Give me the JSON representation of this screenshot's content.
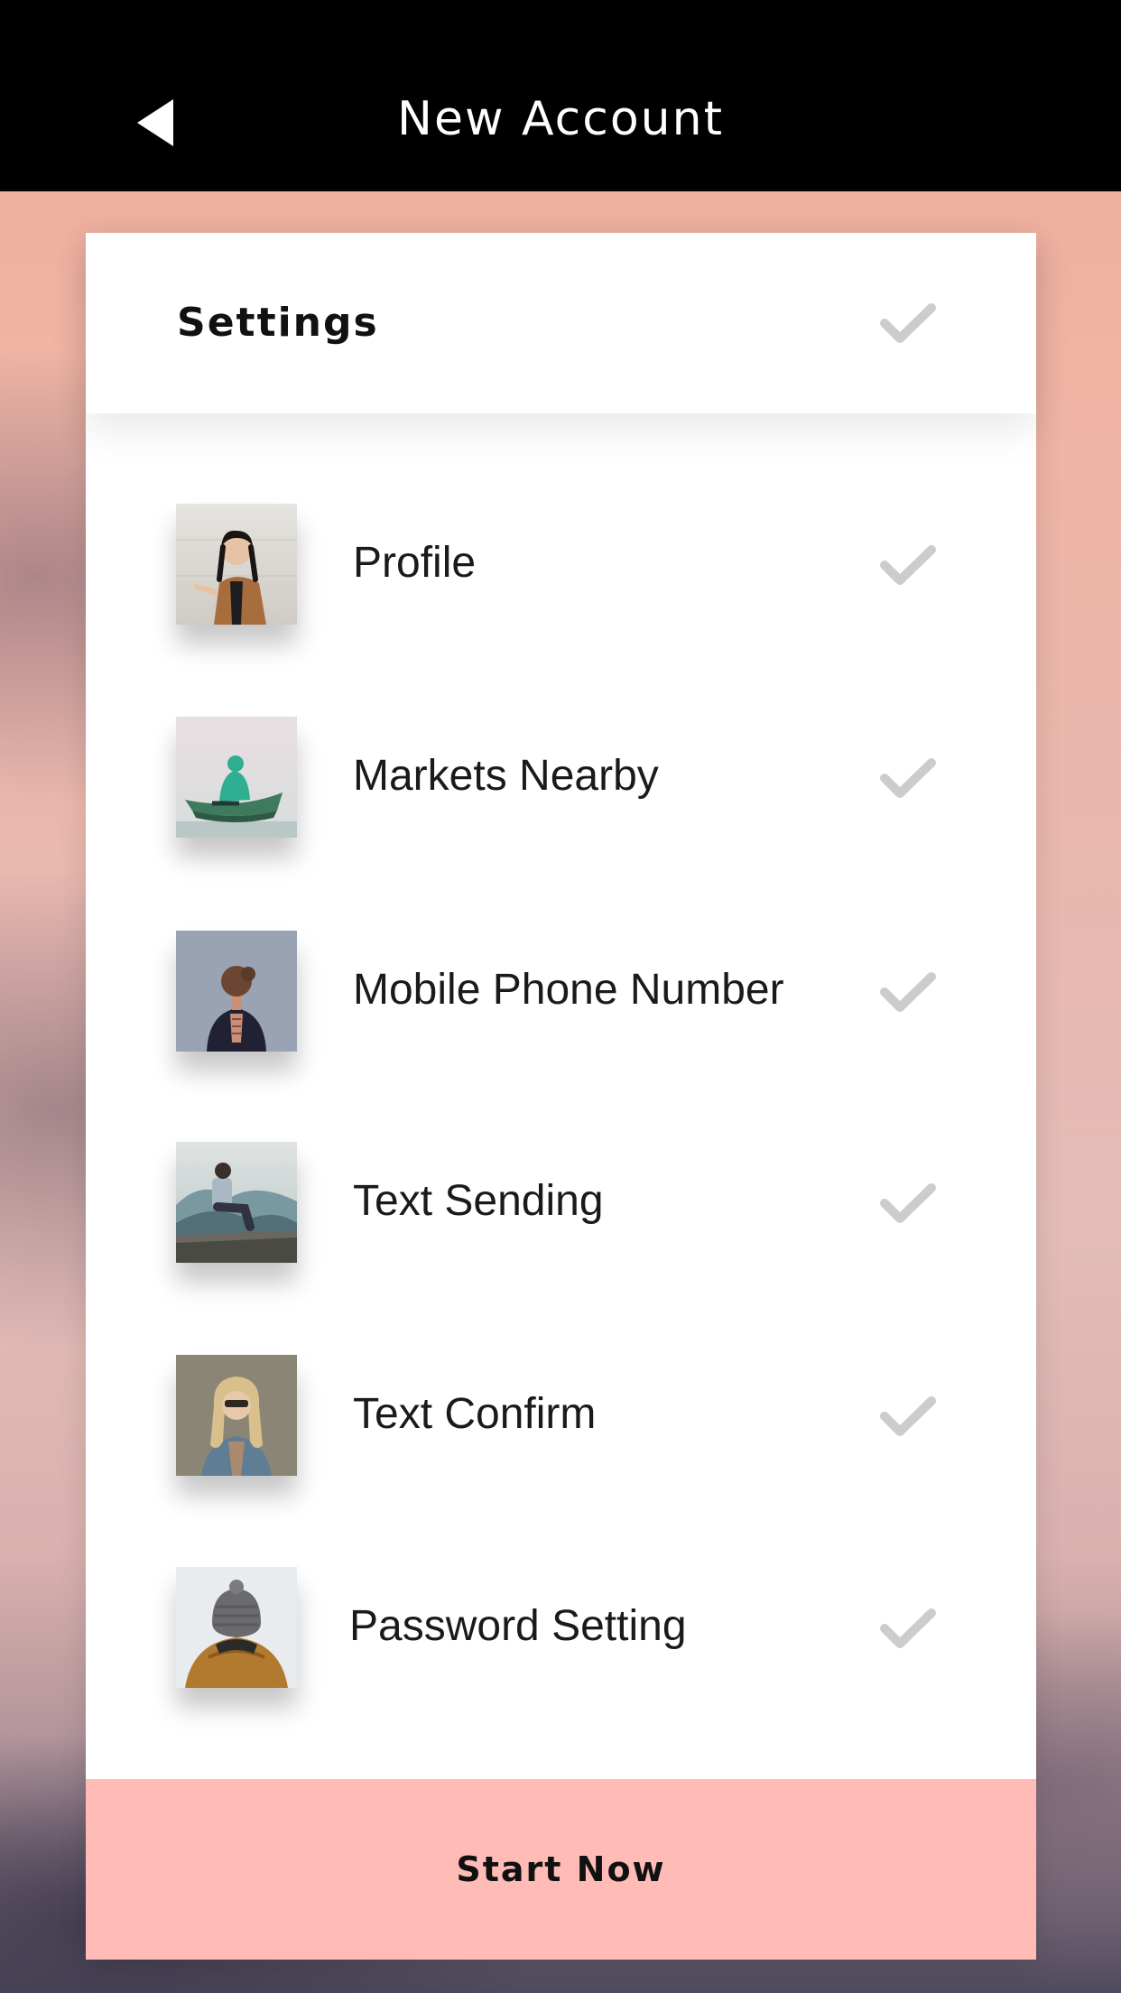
{
  "nav": {
    "title": "New Account",
    "back_icon": "back-arrow-icon"
  },
  "settings": {
    "title": "Settings",
    "check_icon": "checkmark-icon"
  },
  "items": [
    {
      "label": "Profile",
      "thumbnail": "photo-woman-looking-up"
    },
    {
      "label": "Markets Nearby",
      "thumbnail": "photo-person-in-canoe"
    },
    {
      "label": "Mobile Phone Number",
      "thumbnail": "photo-woman-back-view"
    },
    {
      "label": "Text Sending",
      "thumbnail": "photo-man-sitting-mountains"
    },
    {
      "label": "Text Confirm",
      "thumbnail": "photo-woman-blonde"
    },
    {
      "label": "Password Setting",
      "thumbnail": "photo-person-beanie"
    }
  ],
  "cta": {
    "label": "Start Now"
  },
  "colors": {
    "nav_background": "#000000",
    "cta_background": "#ffbbb5",
    "check_gray": "#cccccc",
    "text_dark": "#1a1a1a"
  }
}
